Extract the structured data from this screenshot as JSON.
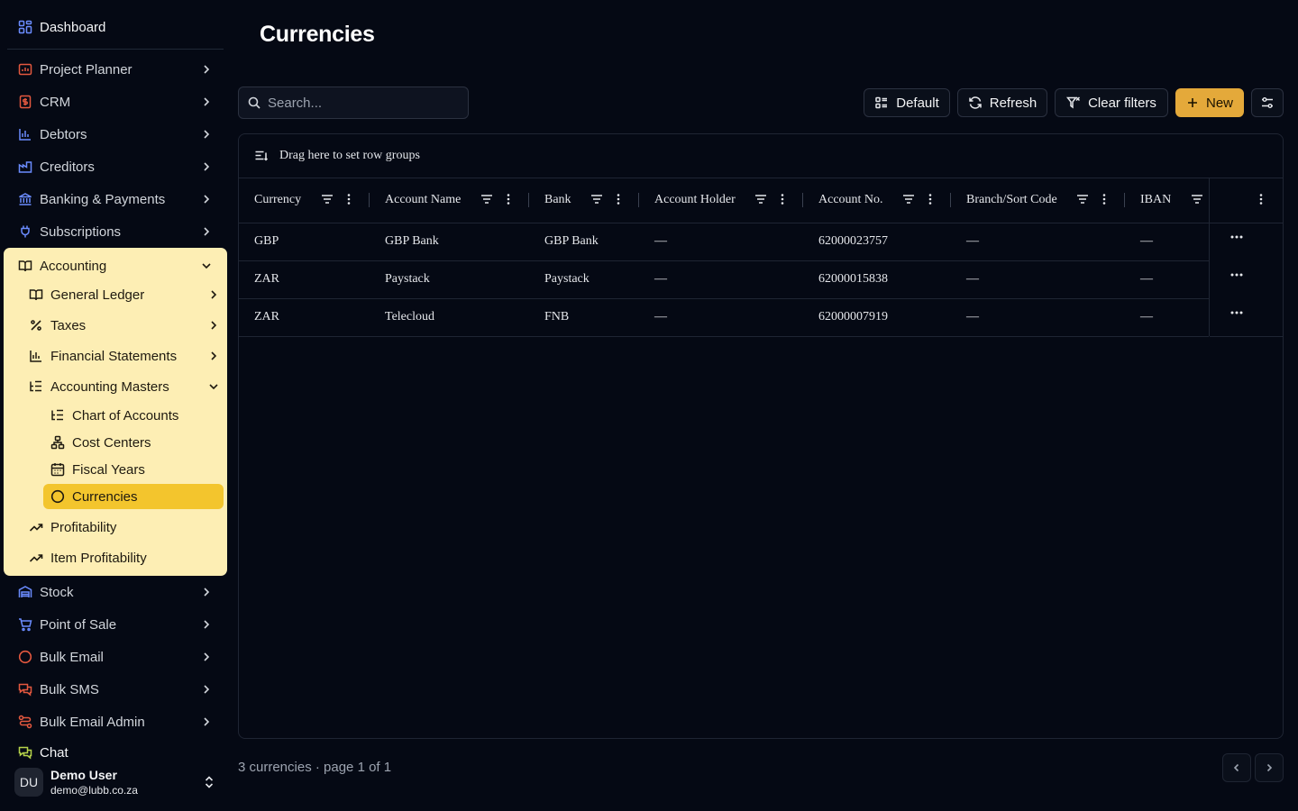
{
  "sidebar": {
    "dashboard": "Dashboard",
    "items": [
      {
        "label": "Project Planner"
      },
      {
        "label": "CRM"
      },
      {
        "label": "Debtors"
      },
      {
        "label": "Creditors"
      },
      {
        "label": "Banking & Payments"
      },
      {
        "label": "Subscriptions"
      }
    ],
    "accounting": {
      "label": "Accounting",
      "children": [
        {
          "label": "General Ledger"
        },
        {
          "label": "Taxes"
        },
        {
          "label": "Financial Statements"
        },
        {
          "label": "Accounting Masters"
        }
      ],
      "masters": [
        {
          "label": "Chart of Accounts"
        },
        {
          "label": "Cost Centers"
        },
        {
          "label": "Fiscal Years"
        },
        {
          "label": "Currencies"
        }
      ],
      "extra": [
        {
          "label": "Profitability"
        },
        {
          "label": "Item Profitability"
        }
      ]
    },
    "bottom_items": [
      {
        "label": "Stock"
      },
      {
        "label": "Point of Sale"
      },
      {
        "label": "Bulk Email"
      },
      {
        "label": "Bulk SMS"
      },
      {
        "label": "Bulk Email Admin"
      },
      {
        "label": "Chat"
      }
    ],
    "user": {
      "initials": "DU",
      "name": "Demo User",
      "email": "demo@lubb.co.za"
    }
  },
  "page": {
    "title": "Currencies"
  },
  "toolbar": {
    "search_placeholder": "Search...",
    "default_label": "Default",
    "refresh_label": "Refresh",
    "clear_label": "Clear filters",
    "new_label": "New"
  },
  "grid": {
    "group_hint": "Drag here to set row groups",
    "columns": [
      "Currency",
      "Account Name",
      "Bank",
      "Account Holder",
      "Account No.",
      "Branch/Sort Code",
      "IBAN"
    ],
    "rows": [
      [
        "GBP",
        "GBP Bank",
        "GBP Bank",
        "—",
        "62000023757",
        "—",
        "—"
      ],
      [
        "ZAR",
        "Paystack",
        "Paystack",
        "—",
        "62000015838",
        "—",
        "—"
      ],
      [
        "ZAR",
        "Telecloud",
        "FNB",
        "—",
        "62000007919",
        "—",
        "—"
      ]
    ]
  },
  "footer": {
    "summary": "3 currencies · page 1 of 1"
  },
  "colors": {
    "accent": "#f3c52d",
    "panel": "#fdeeb4",
    "new_button": "#e4a93a",
    "background": "#050914"
  }
}
